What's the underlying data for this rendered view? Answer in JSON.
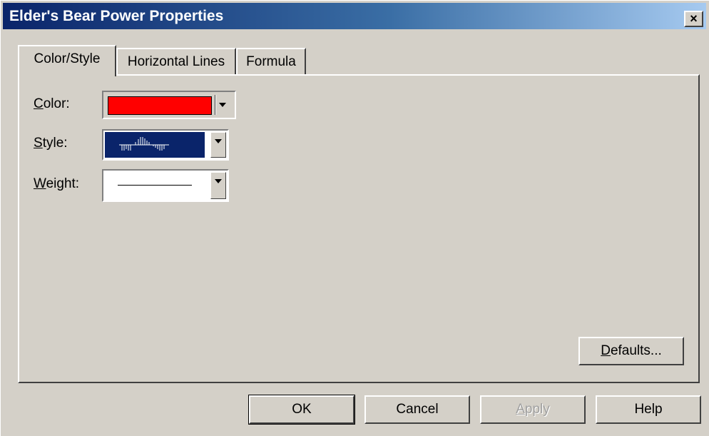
{
  "window": {
    "title": "Elder's Bear Power Properties",
    "close_label": "×"
  },
  "tabs": [
    {
      "label": "Color/Style",
      "active": true
    },
    {
      "label": "Horizontal Lines",
      "active": false
    },
    {
      "label": "Formula",
      "active": false
    }
  ],
  "form": {
    "color_label_prefix": "C",
    "color_label_rest": "olor:",
    "color_value": "#ff0000",
    "style_label_prefix": "S",
    "style_label_rest": "tyle:",
    "style_value_icon": "histogram-icon",
    "weight_label_prefix": "W",
    "weight_label_rest": "eight:",
    "weight_value_icon": "thin-line-icon"
  },
  "buttons": {
    "defaults_prefix": "D",
    "defaults_rest": "efaults...",
    "ok": "OK",
    "cancel": "Cancel",
    "apply_prefix": "A",
    "apply_rest": "pply",
    "help": "Help"
  },
  "colors": {
    "title_start": "#0a246a",
    "title_end": "#a6caf0",
    "dialog_bg": "#d4d0c8",
    "style_selected_bg": "#0a246a",
    "color_swatch": "#ff0000"
  }
}
